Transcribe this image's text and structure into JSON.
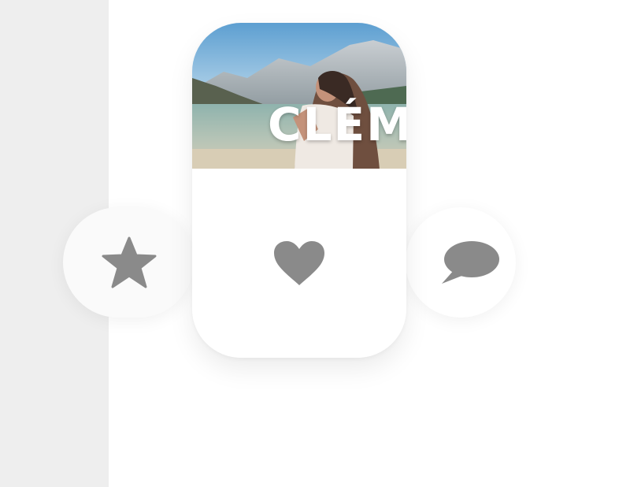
{
  "profile": {
    "name": "CLÉM"
  },
  "actions": {
    "favorite_icon": "star-icon",
    "like_icon": "heart-icon",
    "message_icon": "speech-bubble-icon"
  },
  "colors": {
    "sidebar": "#eeeeee",
    "icon": "#8a8a8a",
    "card": "#ffffff",
    "background": "#ffffff"
  }
}
